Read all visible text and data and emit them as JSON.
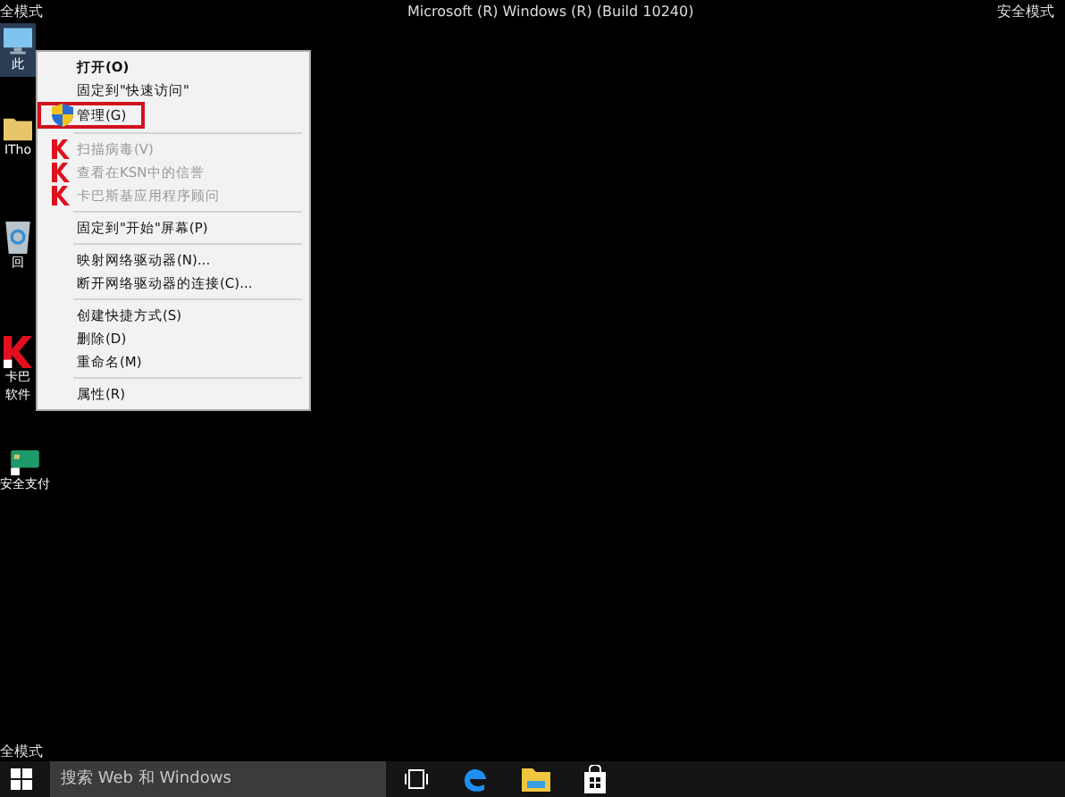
{
  "corner_labels": {
    "top_left": "全模式",
    "top_center": "Microsoft (R) Windows (R) (Build 10240)",
    "top_right": "安全模式",
    "bottom_left": "全模式"
  },
  "desktop_icons": [
    {
      "kind": "computer",
      "lines": [
        "此"
      ],
      "selected": true
    },
    {
      "kind": "folder",
      "lines": [
        "ITho"
      ],
      "selected": false
    },
    {
      "kind": "recycle",
      "lines": [
        "回"
      ],
      "selected": false
    },
    {
      "kind": "kaspersky",
      "lines": [
        "卡巴",
        "软件"
      ],
      "selected": false
    },
    {
      "kind": "card",
      "lines": [
        "安全支付"
      ],
      "selected": false
    }
  ],
  "context_menu": {
    "groups": [
      [
        {
          "label": "打开(O)",
          "kind": "plain",
          "bold": true,
          "disabled": false,
          "highlighted": false
        },
        {
          "label": "固定到\"快速访问\"",
          "kind": "plain",
          "bold": false,
          "disabled": false,
          "highlighted": false
        },
        {
          "label": "管理(G)",
          "kind": "shield",
          "bold": false,
          "disabled": false,
          "highlighted": true
        }
      ],
      [
        {
          "label": "扫描病毒(V)",
          "kind": "kaspersky",
          "bold": false,
          "disabled": true,
          "highlighted": false
        },
        {
          "label": "查看在KSN中的信誉",
          "kind": "kaspersky",
          "bold": false,
          "disabled": true,
          "highlighted": false
        },
        {
          "label": "卡巴斯基应用程序顾问",
          "kind": "kaspersky",
          "bold": false,
          "disabled": true,
          "highlighted": false
        }
      ],
      [
        {
          "label": "固定到\"开始\"屏幕(P)",
          "kind": "plain",
          "bold": false,
          "disabled": false,
          "highlighted": false
        }
      ],
      [
        {
          "label": "映射网络驱动器(N)...",
          "kind": "plain",
          "bold": false,
          "disabled": false,
          "highlighted": false
        },
        {
          "label": "断开网络驱动器的连接(C)...",
          "kind": "plain",
          "bold": false,
          "disabled": false,
          "highlighted": false
        }
      ],
      [
        {
          "label": "创建快捷方式(S)",
          "kind": "plain",
          "bold": false,
          "disabled": false,
          "highlighted": false
        },
        {
          "label": "删除(D)",
          "kind": "plain",
          "bold": false,
          "disabled": false,
          "highlighted": false
        },
        {
          "label": "重命名(M)",
          "kind": "plain",
          "bold": false,
          "disabled": false,
          "highlighted": false
        }
      ],
      [
        {
          "label": "属性(R)",
          "kind": "plain",
          "bold": false,
          "disabled": false,
          "highlighted": false
        }
      ]
    ]
  },
  "taskbar": {
    "search": {
      "placeholder": "搜索 Web 和 Windows"
    },
    "apps": [
      {
        "kind": "task-view"
      },
      {
        "kind": "edge"
      },
      {
        "kind": "explorer"
      },
      {
        "kind": "store"
      }
    ]
  }
}
